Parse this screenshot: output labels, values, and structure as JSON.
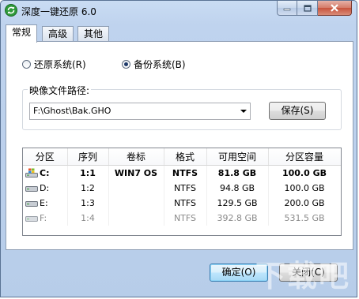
{
  "window": {
    "title": "深度一键还原 6.0",
    "minimize_icon": "minimize-icon",
    "maximize_icon": "maximize-icon",
    "close_icon": "close-icon",
    "app_icon": "refresh-arrows-icon"
  },
  "tabs": [
    {
      "label": "常规",
      "active": true
    },
    {
      "label": "高级",
      "active": false
    },
    {
      "label": "其他",
      "active": false
    }
  ],
  "mode": {
    "restore_label": "还原系统(R)",
    "backup_label": "备份系统(B)",
    "selected": "backup"
  },
  "image_path": {
    "group_label": "映像文件路径:",
    "value": "F:\\Ghost\\Bak.GHO",
    "save_label": "保存(S)"
  },
  "table": {
    "columns": [
      "分区",
      "序列",
      "卷标",
      "格式",
      "可用空间",
      "分区容量"
    ],
    "rows": [
      {
        "drive": "C:",
        "seq": "1:1",
        "label": "WIN7 OS",
        "format": "NTFS",
        "free": "81.8 GB",
        "capacity": "100.0 GB",
        "style": "bold",
        "icon": "system-drive-icon"
      },
      {
        "drive": "D:",
        "seq": "1:2",
        "label": "",
        "format": "NTFS",
        "free": "94.8 GB",
        "capacity": "100.0 GB",
        "style": "normal",
        "icon": "drive-icon"
      },
      {
        "drive": "E:",
        "seq": "1:3",
        "label": "",
        "format": "NTFS",
        "free": "129.5 GB",
        "capacity": "200.0 GB",
        "style": "normal",
        "icon": "drive-icon"
      },
      {
        "drive": "F:",
        "seq": "1:4",
        "label": "",
        "format": "NTFS",
        "free": "392.8 GB",
        "capacity": "531.5 GB",
        "style": "disabled",
        "icon": "drive-icon"
      }
    ]
  },
  "footer": {
    "ok_label": "确定(O)",
    "close_label": "关闭(C)"
  },
  "watermark": "下载吧",
  "colors": {
    "window_bg": "#bfd3ee",
    "close_button": "#c7533c",
    "default_button_border": "#3c7fb1"
  }
}
